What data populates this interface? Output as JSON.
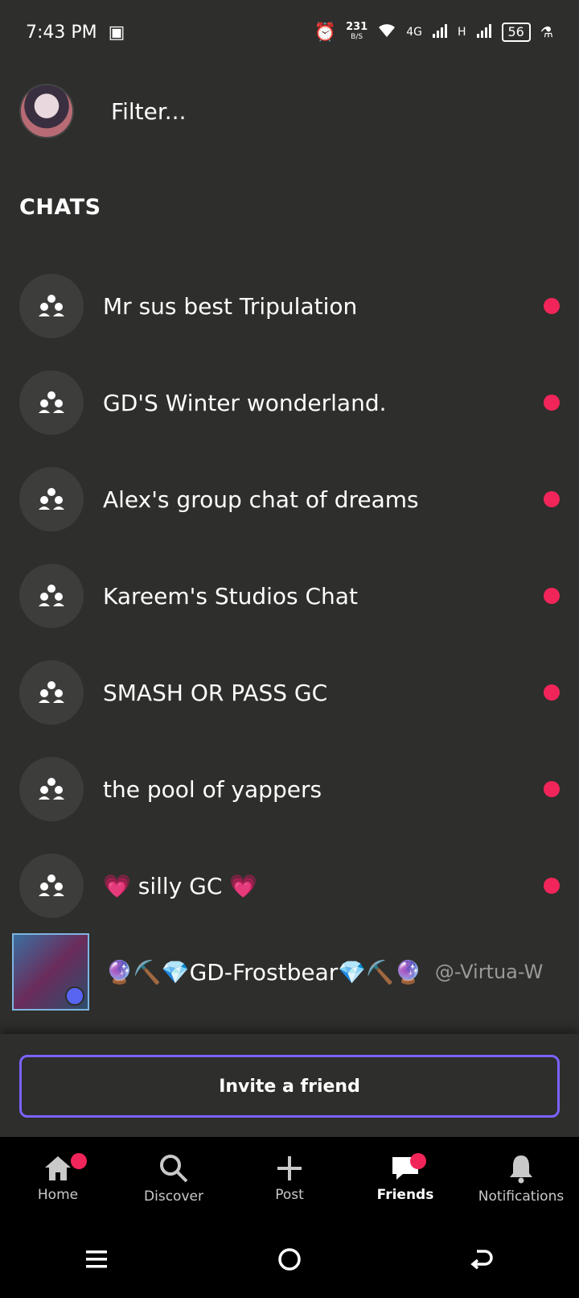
{
  "status_bar": {
    "time": "7:43 PM",
    "speed_value": "231",
    "speed_unit": "B/S",
    "network": "4G",
    "network2": "H",
    "battery": "56"
  },
  "header": {
    "filter_placeholder": "Filter..."
  },
  "chats_section": {
    "title": "CHATS",
    "items": [
      {
        "name": "Mr sus best Tripulation"
      },
      {
        "name": "GD'S Winter wonderland."
      },
      {
        "name": "Alex's group chat of dreams"
      },
      {
        "name": "Kareem's Studios Chat"
      },
      {
        "name": "SMASH OR PASS GC"
      },
      {
        "name": "the pool of yappers"
      },
      {
        "name": "💗 silly GC 💗"
      }
    ]
  },
  "friend": {
    "name": "🔮⛏️💎GD-Frostbear💎⛏️🔮",
    "handle": "@-Virtua-W"
  },
  "invite": {
    "label": "Invite a friend"
  },
  "bottom_nav": {
    "items": [
      {
        "label": "Home",
        "icon": "home-icon"
      },
      {
        "label": "Discover",
        "icon": "search-icon"
      },
      {
        "label": "Post",
        "icon": "plus-icon"
      },
      {
        "label": "Friends",
        "icon": "chat-icon"
      },
      {
        "label": "Notifications",
        "icon": "bell-icon"
      }
    ]
  },
  "colors": {
    "background": "#2e2e2c",
    "unread": "#f2255a",
    "accent": "#7a63ff"
  }
}
